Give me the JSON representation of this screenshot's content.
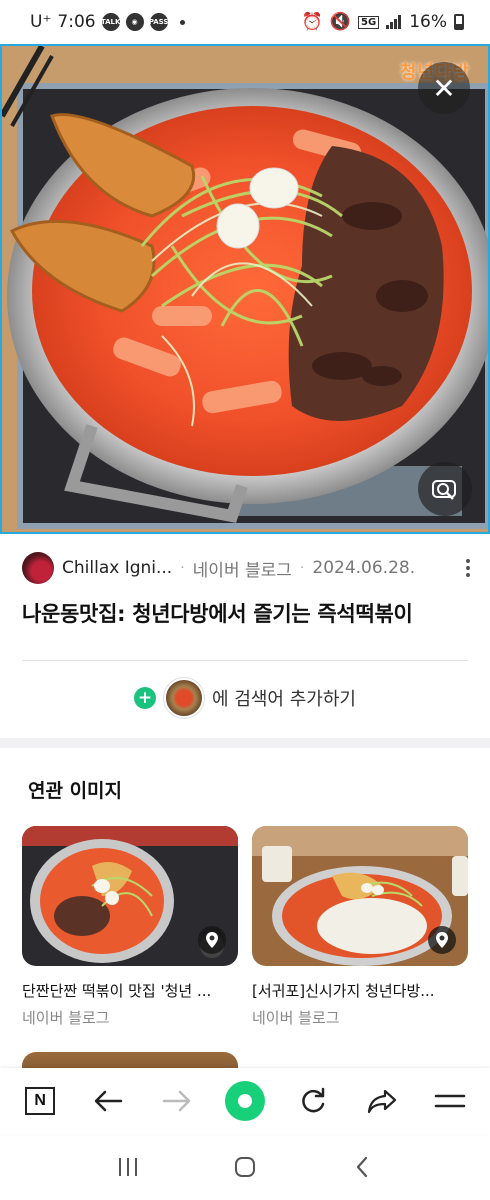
{
  "status_bar": {
    "carrier": "U⁺",
    "time": "7:06",
    "notif_icons": [
      "TALK",
      "app",
      "PASS"
    ],
    "network": "5G",
    "battery": "16%"
  },
  "hero": {
    "watermark": "청년다방",
    "close_label": "✕"
  },
  "source": {
    "name": "Chillax Igni...",
    "platform": "네이버 블로그",
    "date": "2024.06.28."
  },
  "title": "나운동맛집: 청년다방에서 즐기는 즉석떡볶이",
  "add_search": {
    "label": "에 검색어 추가하기"
  },
  "related": {
    "heading": "연관 이미지",
    "cards": [
      {
        "caption": "단짠단짠 떡볶이 맛집 '청년 ...",
        "source": "네이버 블로그"
      },
      {
        "caption": "[서귀포]신시가지 청년다방...",
        "source": "네이버 블로그"
      }
    ]
  },
  "colors": {
    "accent_green": "#19d07a",
    "selection_border": "#2aa8e0"
  }
}
